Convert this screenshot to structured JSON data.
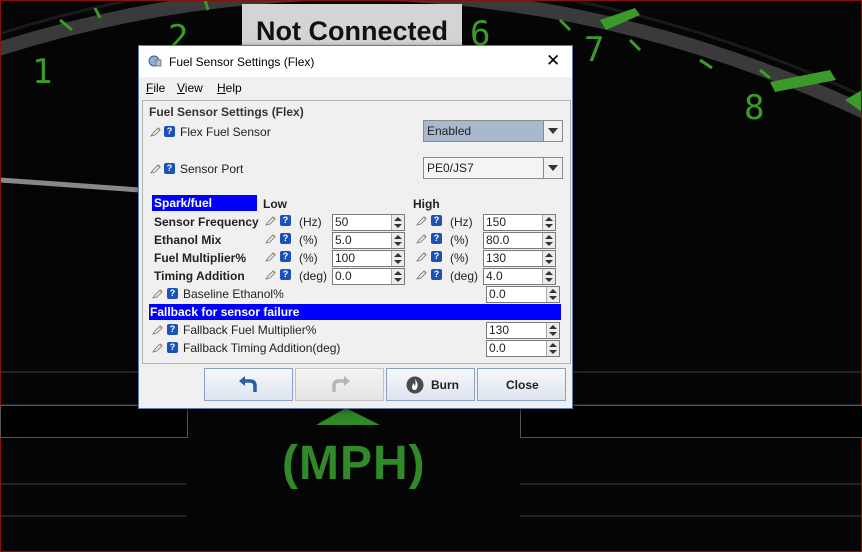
{
  "background": {
    "status_text": "Not Connected",
    "gauge_numbers": [
      "1",
      "2",
      "6",
      "7",
      "8"
    ],
    "units_label": "(MPH)",
    "gauge_color": "#3c9a2a"
  },
  "dialog": {
    "title": "Fuel Sensor Settings (Flex)",
    "close_icon": "close-icon",
    "menu": [
      "File",
      "View",
      "Help"
    ],
    "panel_title": "Fuel Sensor Settings (Flex)",
    "flex_fuel_sensor": {
      "label": "Flex Fuel Sensor",
      "value": "Enabled"
    },
    "sensor_port": {
      "label": "Sensor Port",
      "value": "PE0/JS7"
    },
    "table": {
      "header_label": "Spark/fuel",
      "low_label": "Low",
      "high_label": "High",
      "rows": [
        {
          "label": "Sensor Frequency",
          "low_unit": "(Hz)",
          "low_value": "50",
          "high_unit": "(Hz)",
          "high_value": "150"
        },
        {
          "label": "Ethanol Mix",
          "low_unit": "(%)",
          "low_value": "5.0",
          "high_unit": "(%)",
          "high_value": "80.0"
        },
        {
          "label": "Fuel Multiplier%",
          "low_unit": "(%)",
          "low_value": "100",
          "high_unit": "(%)",
          "high_value": "130"
        },
        {
          "label": "Timing Addition",
          "low_unit": "(deg)",
          "low_value": "0.0",
          "high_unit": "(deg)",
          "high_value": "4.0"
        }
      ]
    },
    "baseline_ethanol": {
      "label": "Baseline Ethanol%",
      "value": "0.0"
    },
    "fallback_header": "Fallback for sensor failure",
    "fallback_fuel_multiplier": {
      "label": "Fallback Fuel Multiplier%",
      "value": "130"
    },
    "fallback_timing_addition": {
      "label": "Fallback Timing Addition(deg)",
      "value": "0.0"
    },
    "buttons": {
      "undo_icon": "undo-icon",
      "redo_icon": "redo-icon",
      "burn_label": "Burn",
      "close_label": "Close"
    },
    "colors": {
      "highlight": "#0000ff",
      "help_icon": "#1a52b8",
      "dropdown_selected": "#a9b8cc"
    }
  }
}
